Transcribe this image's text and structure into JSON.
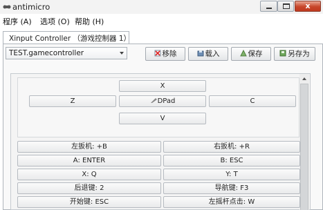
{
  "window": {
    "title": "antimicro",
    "min_label": "",
    "max_label": "",
    "close_label": "x"
  },
  "menu": {
    "items": [
      "程序 (A)",
      "选项 (O)",
      "帮助 (H)"
    ]
  },
  "tab": {
    "label": "Xinput Controller （游戏控制器 1）"
  },
  "profile": {
    "selected": "TEST.gamecontroller"
  },
  "toolbar": {
    "remove": "移除",
    "load": "载入",
    "save": "保存",
    "save_as": "另存为"
  },
  "dpad": {
    "up": "X",
    "left": "Z",
    "center": "DPad",
    "right": "C",
    "down": "V"
  },
  "mappings": [
    {
      "left": "左扳机: +B",
      "right": "右扳机: +R"
    },
    {
      "left": "A: ENTER",
      "right": "B: ESC"
    },
    {
      "left": "X: Q",
      "right": "Y: T"
    },
    {
      "left": "后退键: 2",
      "right": "导航键: F3"
    },
    {
      "left": "开始键: ESC",
      "right": "左摇杆点击: W"
    }
  ],
  "colors": {
    "close_button": "#c7462a",
    "tab_border": "#aeb4bb"
  },
  "icons": [
    "app-icon",
    "remove-icon",
    "load-icon",
    "save-icon",
    "save-as-icon",
    "dpad-icon",
    "scroll-up-icon"
  ]
}
